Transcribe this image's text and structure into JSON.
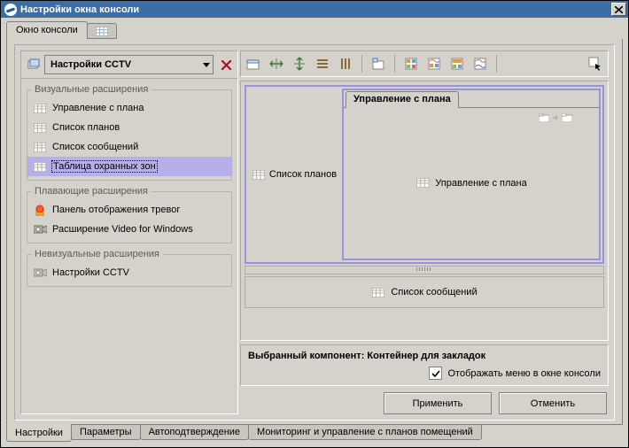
{
  "title": "Настройки окна консоли",
  "top_tabs": {
    "main": "Окно консоли"
  },
  "dropdown": {
    "label": "Настройки CCTV"
  },
  "groups": {
    "visual": {
      "legend": "Визуальные расширения",
      "items": [
        {
          "label": "Управление с плана"
        },
        {
          "label": "Список планов"
        },
        {
          "label": "Список сообщений"
        },
        {
          "label": "Таблица охранных зон"
        }
      ]
    },
    "floating": {
      "legend": "Плавающие расширения",
      "items": [
        {
          "label": "Панель отображения тревог"
        },
        {
          "label": "Расширение Video for Windows"
        }
      ]
    },
    "nonvisual": {
      "legend": "Невизуальные расширения",
      "items": [
        {
          "label": "Настройки CCTV"
        }
      ]
    }
  },
  "layout": {
    "left_pane_label": "Список планов",
    "right_tab_label": "Управление с плана",
    "right_center_label": "Управление с плана",
    "bottom_pane_label": "Список сообщений"
  },
  "info": {
    "selected_component_prefix": "Выбранный компонент: ",
    "selected_component_value": "Контейнер для закладок",
    "checkbox_label": "Отображать меню в окне консоли",
    "checkbox_checked": true
  },
  "buttons": {
    "apply": "Применить",
    "cancel": "Отменить"
  },
  "bottom_tabs": [
    "Настройки",
    "Параметры",
    "Автоподтверждение",
    "Мониторинг и управление с планов помещений"
  ]
}
